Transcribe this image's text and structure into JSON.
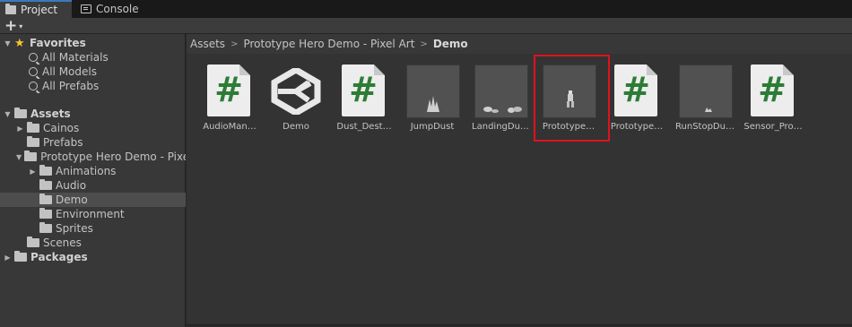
{
  "tabs": [
    {
      "label": "Project",
      "icon": "folder-icon",
      "active": true
    },
    {
      "label": "Console",
      "icon": "console-icon",
      "active": false
    }
  ],
  "toolbar": {
    "create_label": "+",
    "create_caret": "▾"
  },
  "tree": {
    "favorites": {
      "label": "Favorites",
      "items": [
        "All Materials",
        "All Models",
        "All Prefabs"
      ]
    },
    "assets": {
      "label": "Assets",
      "children": {
        "cainos": "Cainos",
        "prefabs": "Prefabs",
        "prototype": "Prototype Hero Demo - Pixel Art",
        "animations": "Animations",
        "audio": "Audio",
        "demo": "Demo",
        "environment": "Environment",
        "sprites": "Sprites",
        "scenes": "Scenes"
      }
    },
    "packages": {
      "label": "Packages"
    }
  },
  "breadcrumb": [
    "Assets",
    "Prototype Hero Demo - Pixel Art",
    "Demo"
  ],
  "assets_grid": [
    {
      "label": "AudioMan…",
      "type": "script"
    },
    {
      "label": "Demo",
      "type": "scene"
    },
    {
      "label": "Dust_Dest…",
      "type": "script"
    },
    {
      "label": "JumpDust",
      "type": "prefab"
    },
    {
      "label": "LandingDu…",
      "type": "prefab"
    },
    {
      "label": "Prototype…",
      "type": "prefab",
      "highlighted": true
    },
    {
      "label": "Prototype…",
      "type": "script"
    },
    {
      "label": "RunStopDu…",
      "type": "prefab"
    },
    {
      "label": "Sensor_Pro…",
      "type": "script"
    }
  ],
  "colors": {
    "script_hash": "#2d7c36",
    "highlight_border": "#e0121c",
    "selected_row": "#4d4d4d",
    "star": "#f4c430"
  }
}
